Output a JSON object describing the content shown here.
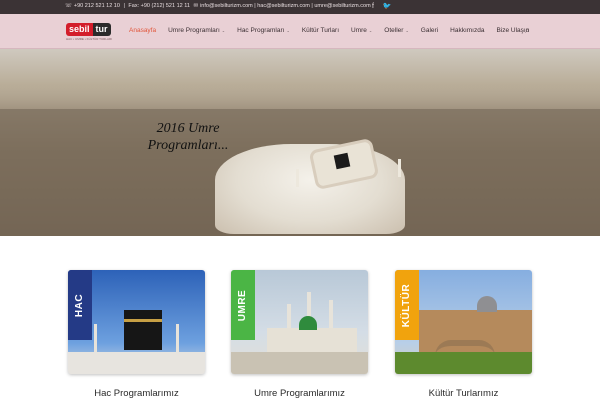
{
  "topbar": {
    "phone": "+90 212 521 12 10",
    "fax": "Fax: +90 (212) 521 12 11",
    "email_icon": "mail-icon",
    "email_text": "info@sebilturizm.com | hac@sebilturizm.com | umre@sebilturizm.com",
    "social": [
      "facebook-icon",
      "twitter-icon"
    ]
  },
  "logo": {
    "part1": "sebil",
    "part2": "tur",
    "tagline": "HAC • UMRE • KÜLTÜR TURLARI"
  },
  "nav": {
    "items": [
      {
        "label": "Anasayfa",
        "active": true,
        "dropdown": false
      },
      {
        "label": "Umre Programları",
        "dropdown": true
      },
      {
        "label": "Hac Programları",
        "dropdown": true
      },
      {
        "label": "Kültür Turları",
        "dropdown": false
      },
      {
        "label": "Umre",
        "dropdown": true
      },
      {
        "label": "Oteller",
        "dropdown": true
      },
      {
        "label": "Galeri",
        "dropdown": false
      },
      {
        "label": "Hakkımızda",
        "dropdown": false
      },
      {
        "label": "Bize Ulaşın",
        "dropdown": false
      }
    ],
    "search_icon": "search-icon",
    "chevron": "⌄"
  },
  "hero": {
    "line1": "2016 Umre",
    "line2": "Programları..."
  },
  "cards": [
    {
      "tag": "HAC",
      "caption": "Hac Programlarımız",
      "color": "#243a86"
    },
    {
      "tag": "UMRE",
      "caption": "Umre Programlarımız",
      "color": "#4bb545"
    },
    {
      "tag": "KÜLTÜR",
      "caption": "Kültür Turlarımız",
      "color": "#f1a30d"
    }
  ],
  "colors": {
    "accent": "#e2563b",
    "header_bg": "#e9d0d5",
    "topbar_bg": "#3b3335"
  }
}
